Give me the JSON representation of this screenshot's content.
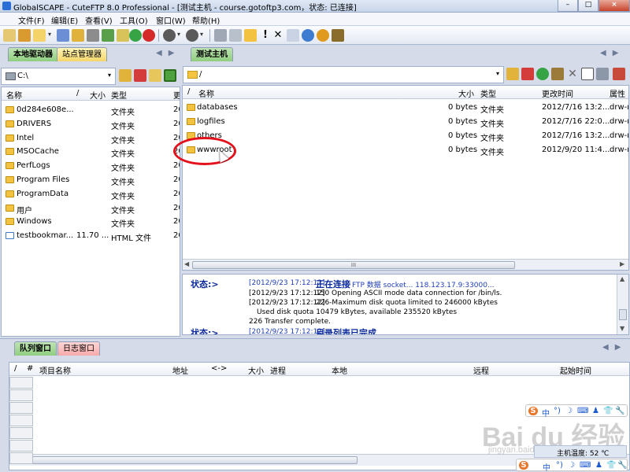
{
  "window": {
    "title": "GlobalSCAPE - CuteFTP 8.0 Professional - [测试主机 - course.gotoftp3.com，状态: 已连接]",
    "buttons": [
      "–",
      "□",
      "×"
    ]
  },
  "menu": [
    "文件(F)",
    "编辑(E)",
    "查看(V)",
    "工具(O)",
    "窗口(W)",
    "帮助(H)"
  ],
  "toolbar": {
    "icons": [
      "new-connection-icon",
      "quick-connect-icon",
      "connect-icon",
      "disconnect-icon",
      "reconnect-icon",
      "site-manager-icon",
      "lock-icon",
      "refresh-icon",
      "stop-icon",
      "download-icon",
      "upload-icon",
      "edit-icon",
      "view-icon",
      "new-folder-icon",
      "exclamation-icon",
      "delete-icon",
      "properties-icon",
      "help-icon",
      "support-icon",
      "exit-icon"
    ]
  },
  "left_panel": {
    "tabs": [
      "本地驱动器",
      "站点管理器"
    ],
    "path": "C:\\",
    "columns": [
      "名称",
      "/",
      "大小",
      "类型",
      "更"
    ],
    "rows": [
      {
        "name": "0d284e608e...",
        "size": "",
        "type": "文件夹",
        "date": "20"
      },
      {
        "name": "DRIVERS",
        "size": "",
        "type": "文件夹",
        "date": "20"
      },
      {
        "name": "Intel",
        "size": "",
        "type": "文件夹",
        "date": "20"
      },
      {
        "name": "MSOCache",
        "size": "",
        "type": "文件夹",
        "date": "20"
      },
      {
        "name": "PerfLogs",
        "size": "",
        "type": "文件夹",
        "date": "20"
      },
      {
        "name": "Program Files",
        "size": "",
        "type": "文件夹",
        "date": "20"
      },
      {
        "name": "ProgramData",
        "size": "",
        "type": "文件夹",
        "date": "20"
      },
      {
        "name": "用户",
        "size": "",
        "type": "文件夹",
        "date": "20"
      },
      {
        "name": "Windows",
        "size": "",
        "type": "文件夹",
        "date": "20"
      },
      {
        "name": "testbookmar...",
        "size": "11.70 ...",
        "type": "HTML 文件",
        "date": "20"
      }
    ]
  },
  "right_panel": {
    "tab": "测试主机",
    "path": "/",
    "columns": [
      "/",
      "名称",
      "大小",
      "类型",
      "更改时间",
      "属性"
    ],
    "rows": [
      {
        "name": "databases",
        "size": "0 bytes",
        "type": "文件夹",
        "date": "2012/7/16 13:2...",
        "attr": "drw-r"
      },
      {
        "name": "logfiles",
        "size": "0 bytes",
        "type": "文件夹",
        "date": "2012/7/16 22:0...",
        "attr": "drw-r"
      },
      {
        "name": "others",
        "size": "0 bytes",
        "type": "文件夹",
        "date": "2012/7/16 13:2...",
        "attr": "drw-r"
      },
      {
        "name": "wwwroot",
        "size": "0 bytes",
        "type": "文件夹",
        "date": "2012/9/20 11:4...",
        "attr": "drw-r"
      }
    ],
    "scroll_thumb": "III"
  },
  "log": {
    "label1": "状态:>",
    "lines": [
      {
        "ts": "[2012/9/23 17:12:12]",
        "text_big": "正在连接",
        "text": "FTP 数据 socket... 118.123.17.9:33000..."
      },
      {
        "ts": "[2012/9/23 17:12:12]",
        "text": "150 Opening ASCII mode data connection for /bin/ls."
      },
      {
        "ts": "[2012/9/23 17:12:12]",
        "text": "226-Maximum disk quota limited to 246000 kBytes"
      },
      {
        "ts": "",
        "text": "Used disk quota 10479 kBytes, available 235520 kBytes"
      },
      {
        "ts": "",
        "text": "226 Transfer complete."
      }
    ],
    "label2": "状态:>",
    "last_ts": "[2012/9/23 17:12:12]",
    "last_text": "目录列表已完成"
  },
  "queue": {
    "tabs": [
      "队列窗口",
      "日志窗口"
    ],
    "columns": [
      "/",
      "#",
      "项目名称",
      "地址",
      "<->",
      "大小",
      "进程",
      "本地",
      "远程",
      "起始时间"
    ]
  },
  "overlay": {
    "ime": [
      "S",
      "中",
      "°)",
      "☽",
      "⌨",
      "♟",
      "👕",
      "🔧"
    ],
    "watermark": "Bai du 经验",
    "watermark_sub": "jingyan.baidu.com",
    "temp": "主机温度: 52 ℃"
  }
}
